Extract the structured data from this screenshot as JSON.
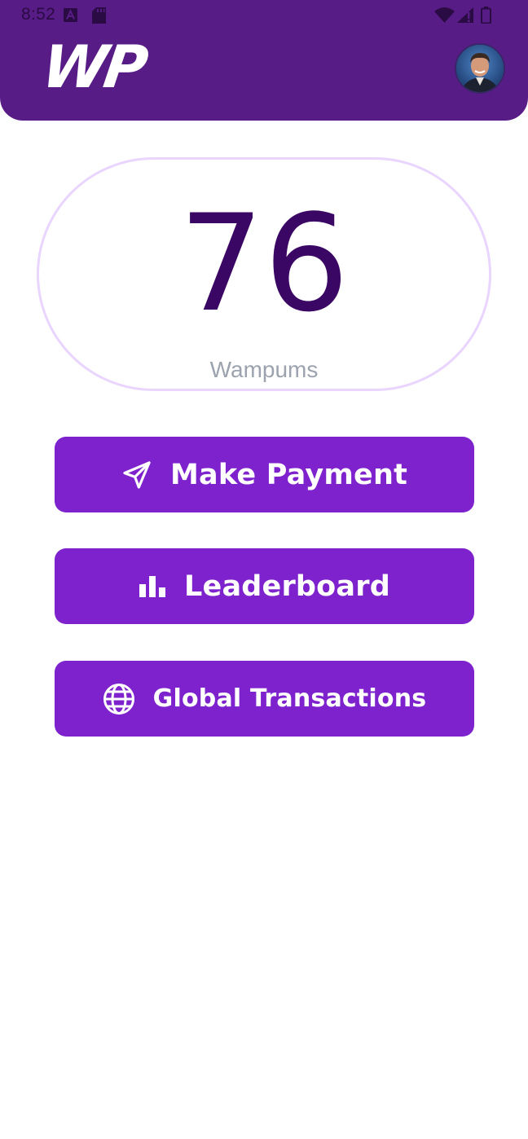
{
  "status_bar": {
    "time": "8:52",
    "icons": [
      "accessibility-icon",
      "sd-card-icon",
      "wifi-icon",
      "cellular-signal-icon",
      "battery-icon"
    ]
  },
  "header": {
    "logo_text": "WP",
    "avatar_icon": "user-avatar",
    "background_color": "#581c87"
  },
  "balance": {
    "value": "76",
    "label": "Wampums",
    "value_color": "#3b0764",
    "border_color": "#e9d5ff"
  },
  "actions": [
    {
      "label": "Make Payment",
      "icon": "send-icon"
    },
    {
      "label": "Leaderboard",
      "icon": "bar-chart-icon"
    },
    {
      "label": "Global Transactions",
      "icon": "globe-icon"
    }
  ],
  "colors": {
    "button": "#7e22ce",
    "button_text": "#ffffff"
  }
}
